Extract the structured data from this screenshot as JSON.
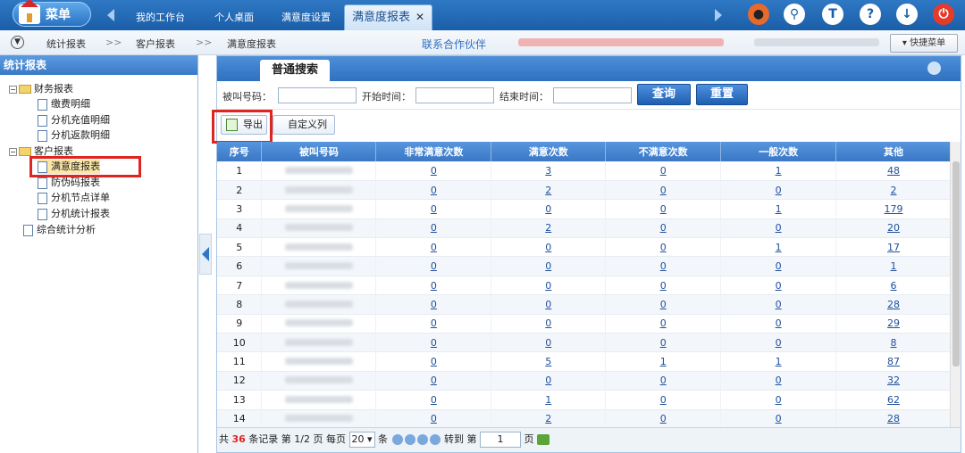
{
  "topbar": {
    "menu_label": "菜单",
    "tabs": [
      "我的工作台",
      "个人桌面",
      "满意度设置",
      "满意度报表"
    ],
    "close_glyph": "✕",
    "icons": [
      "ninja-icon",
      "search-icon",
      "shirt-icon",
      "help-icon",
      "download-icon",
      "power-icon"
    ],
    "icon_glyphs": [
      "●",
      "⚲",
      "T",
      "?",
      "↓",
      "⏻"
    ]
  },
  "breadcrumb": {
    "items": [
      "统计报表",
      "客户报表",
      "满意度报表"
    ],
    "sep": ">>",
    "partner": "联系合作伙伴",
    "quick_menu": "▾ 快捷菜单"
  },
  "sidebar": {
    "title": "统计报表",
    "tree": [
      {
        "label": "财务报表",
        "type": "folder",
        "toggle": "−"
      },
      {
        "label": "缴费明细",
        "type": "doc"
      },
      {
        "label": "分机充值明细",
        "type": "doc"
      },
      {
        "label": "分机返款明细",
        "type": "doc"
      },
      {
        "label": "客户报表",
        "type": "folder",
        "toggle": "−"
      },
      {
        "label": "满意度报表",
        "type": "doc",
        "selected": true
      },
      {
        "label": "防伪码报表",
        "type": "doc"
      },
      {
        "label": "分机节点详单",
        "type": "doc"
      },
      {
        "label": "分机统计报表",
        "type": "doc"
      },
      {
        "label": "综合统计分析",
        "type": "doc"
      }
    ]
  },
  "main": {
    "tab": "普通搜索",
    "search": {
      "called_label": "被叫号码：",
      "start_label": "开始时间：",
      "end_label": "结束时间：",
      "query": "查询",
      "reset": "重置"
    },
    "toolbar": {
      "export": "导出",
      "custom_cols": "自定义列"
    },
    "columns": [
      "序号",
      "被叫号码",
      "非常满意次数",
      "满意次数",
      "不满意次数",
      "一般次数",
      "其他"
    ],
    "rows": [
      [
        "1",
        "0",
        "3",
        "0",
        "1",
        "48"
      ],
      [
        "2",
        "0",
        "2",
        "0",
        "0",
        "2"
      ],
      [
        "3",
        "0",
        "0",
        "0",
        "1",
        "179"
      ],
      [
        "4",
        "0",
        "2",
        "0",
        "0",
        "20"
      ],
      [
        "5",
        "0",
        "0",
        "0",
        "1",
        "17"
      ],
      [
        "6",
        "0",
        "0",
        "0",
        "0",
        "1"
      ],
      [
        "7",
        "0",
        "0",
        "0",
        "0",
        "6"
      ],
      [
        "8",
        "0",
        "0",
        "0",
        "0",
        "28"
      ],
      [
        "9",
        "0",
        "0",
        "0",
        "0",
        "29"
      ],
      [
        "10",
        "0",
        "0",
        "0",
        "0",
        "8"
      ],
      [
        "11",
        "0",
        "5",
        "1",
        "1",
        "87"
      ],
      [
        "12",
        "0",
        "0",
        "0",
        "0",
        "32"
      ],
      [
        "13",
        "0",
        "1",
        "0",
        "0",
        "62"
      ],
      [
        "14",
        "0",
        "2",
        "0",
        "0",
        "28"
      ]
    ],
    "pager": {
      "total_prefix": "共",
      "total": "36",
      "total_suffix": "条记录 第 1/2 页 每页",
      "per_page": "20 ▾",
      "per_unit": "条",
      "goto_prefix": "转到 第",
      "goto_value": "1",
      "goto_suffix": "页"
    }
  }
}
